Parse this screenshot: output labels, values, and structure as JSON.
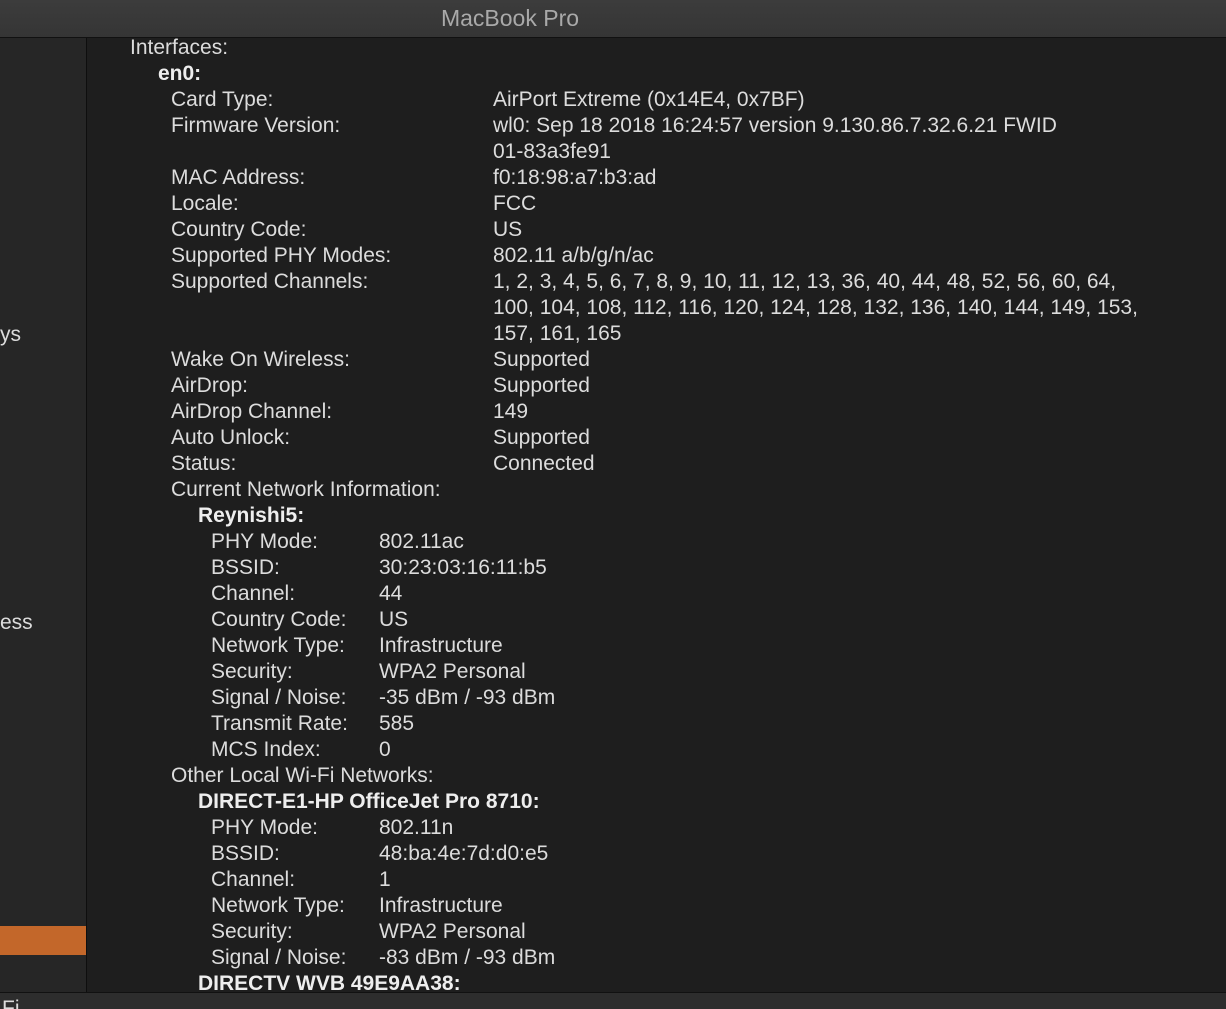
{
  "window": {
    "title": "MacBook Pro"
  },
  "sidebar": {
    "fragment_1": "ys",
    "fragment_2": "ess"
  },
  "bottom": {
    "fragment": "Fi"
  },
  "tree": {
    "interfaces_label": "Interfaces:",
    "en0_label": "en0:",
    "card": [
      {
        "label": "Card Type:",
        "value": "AirPort Extreme  (0x14E4, 0x7BF)"
      },
      {
        "label": "Firmware Version:",
        "value": "wl0: Sep 18 2018 16:24:57 version 9.130.86.7.32.6.21 FWID",
        "value2": "01-83a3fe91"
      },
      {
        "label": "MAC Address:",
        "value": "f0:18:98:a7:b3:ad"
      },
      {
        "label": "Locale:",
        "value": "FCC"
      },
      {
        "label": "Country Code:",
        "value": "US"
      },
      {
        "label": "Supported PHY Modes:",
        "value": "802.11 a/b/g/n/ac"
      },
      {
        "label": "Supported Channels:",
        "value": "1, 2, 3, 4, 5, 6, 7, 8, 9, 10, 11, 12, 13, 36, 40, 44, 48, 52, 56, 60, 64,",
        "value2": "100, 104, 108, 112, 116, 120, 124, 128, 132, 136, 140, 144, 149, 153,",
        "value3": "157, 161, 165"
      },
      {
        "label": "Wake On Wireless:",
        "value": "Supported"
      },
      {
        "label": "AirDrop:",
        "value": "Supported"
      },
      {
        "label": "AirDrop Channel:",
        "value": "149"
      },
      {
        "label": "Auto Unlock:",
        "value": "Supported"
      },
      {
        "label": "Status:",
        "value": "Connected"
      }
    ],
    "current_label": "Current Network Information:",
    "current_network": {
      "name": "Reynishi5:",
      "fields": [
        {
          "label": "PHY Mode:",
          "value": "802.11ac"
        },
        {
          "label": "BSSID:",
          "value": "30:23:03:16:11:b5"
        },
        {
          "label": "Channel:",
          "value": "44"
        },
        {
          "label": "Country Code:",
          "value": "US"
        },
        {
          "label": "Network Type:",
          "value": "Infrastructure"
        },
        {
          "label": "Security:",
          "value": "WPA2 Personal"
        },
        {
          "label": "Signal / Noise:",
          "value": "-35 dBm / -93 dBm"
        },
        {
          "label": "Transmit Rate:",
          "value": "585"
        },
        {
          "label": "MCS Index:",
          "value": "0"
        }
      ]
    },
    "other_label": "Other Local Wi-Fi Networks:",
    "other_networks": [
      {
        "name": "DIRECT-E1-HP OfficeJet Pro 8710:",
        "fields": [
          {
            "label": "PHY Mode:",
            "value": "802.11n"
          },
          {
            "label": "BSSID:",
            "value": "48:ba:4e:7d:d0:e5"
          },
          {
            "label": "Channel:",
            "value": "1"
          },
          {
            "label": "Network Type:",
            "value": "Infrastructure"
          },
          {
            "label": "Security:",
            "value": "WPA2 Personal"
          },
          {
            "label": "Signal / Noise:",
            "value": "-83 dBm / -93 dBm"
          }
        ]
      },
      {
        "name": "DIRECTV WVB 49E9AA38:"
      }
    ]
  }
}
